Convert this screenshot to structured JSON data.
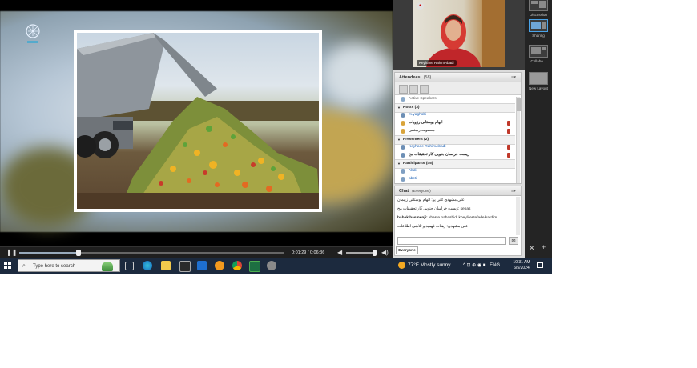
{
  "video": {
    "current_time": "0:01:29",
    "separator": "/",
    "total_time": "0:06:36",
    "progress": 0.225,
    "volume": 0.92
  },
  "camera": {
    "name": "Keyhane RahimAbadi"
  },
  "attendees": {
    "title": "Attendees",
    "count": "(58)",
    "active_speakers": "Active Speakers",
    "groups": [
      {
        "label": "Hosts",
        "count": "(3)"
      },
      {
        "label": "Presenters",
        "count": "(2)"
      },
      {
        "label": "Participants",
        "count": "(45)"
      }
    ],
    "hosts": [
      "m.yaghobi",
      "الهام بوستانی رزوبات",
      "معصومه رستمی"
    ],
    "presenters": [
      "Keyhane RahimAbadi",
      "زیست خراسان جنوبی کار تحقیقات مح"
    ],
    "participants": [
      "Abdi",
      "abeti"
    ]
  },
  "chat": {
    "title": "Chat",
    "scope": "(Everyone)",
    "messages": [
      {
        "sender": "",
        "text": "علی مشهدی ثانی پر: الهام بوستانی زیبمان"
      },
      {
        "sender": "",
        "text": "زیست خراسان جنوبی کار تحقیقات مح: sepas"
      },
      {
        "sender": "babak basmenji:",
        "text": "khaste nabashid. kheyli estefade kardim"
      },
      {
        "sender": "",
        "text": "علی مشهدی: رهبات فهمید و تلاشی اطلاعات"
      }
    ],
    "tab_label": "Everyone"
  },
  "layouts": {
    "items": [
      "Discussion",
      "Sharing",
      "Collabo...",
      "New Layout"
    ],
    "selected": "Sharing",
    "add_symbol": "+",
    "tools_symbol": "✕"
  },
  "taskbar": {
    "search_placeholder": "Type here to search",
    "weather": "77°F  Mostly sunny",
    "time": "10:31 AM",
    "date": "6/5/2024",
    "lang": "ENG",
    "tray_symbols": "^ ⊡ ⊕ ◉ ■"
  }
}
